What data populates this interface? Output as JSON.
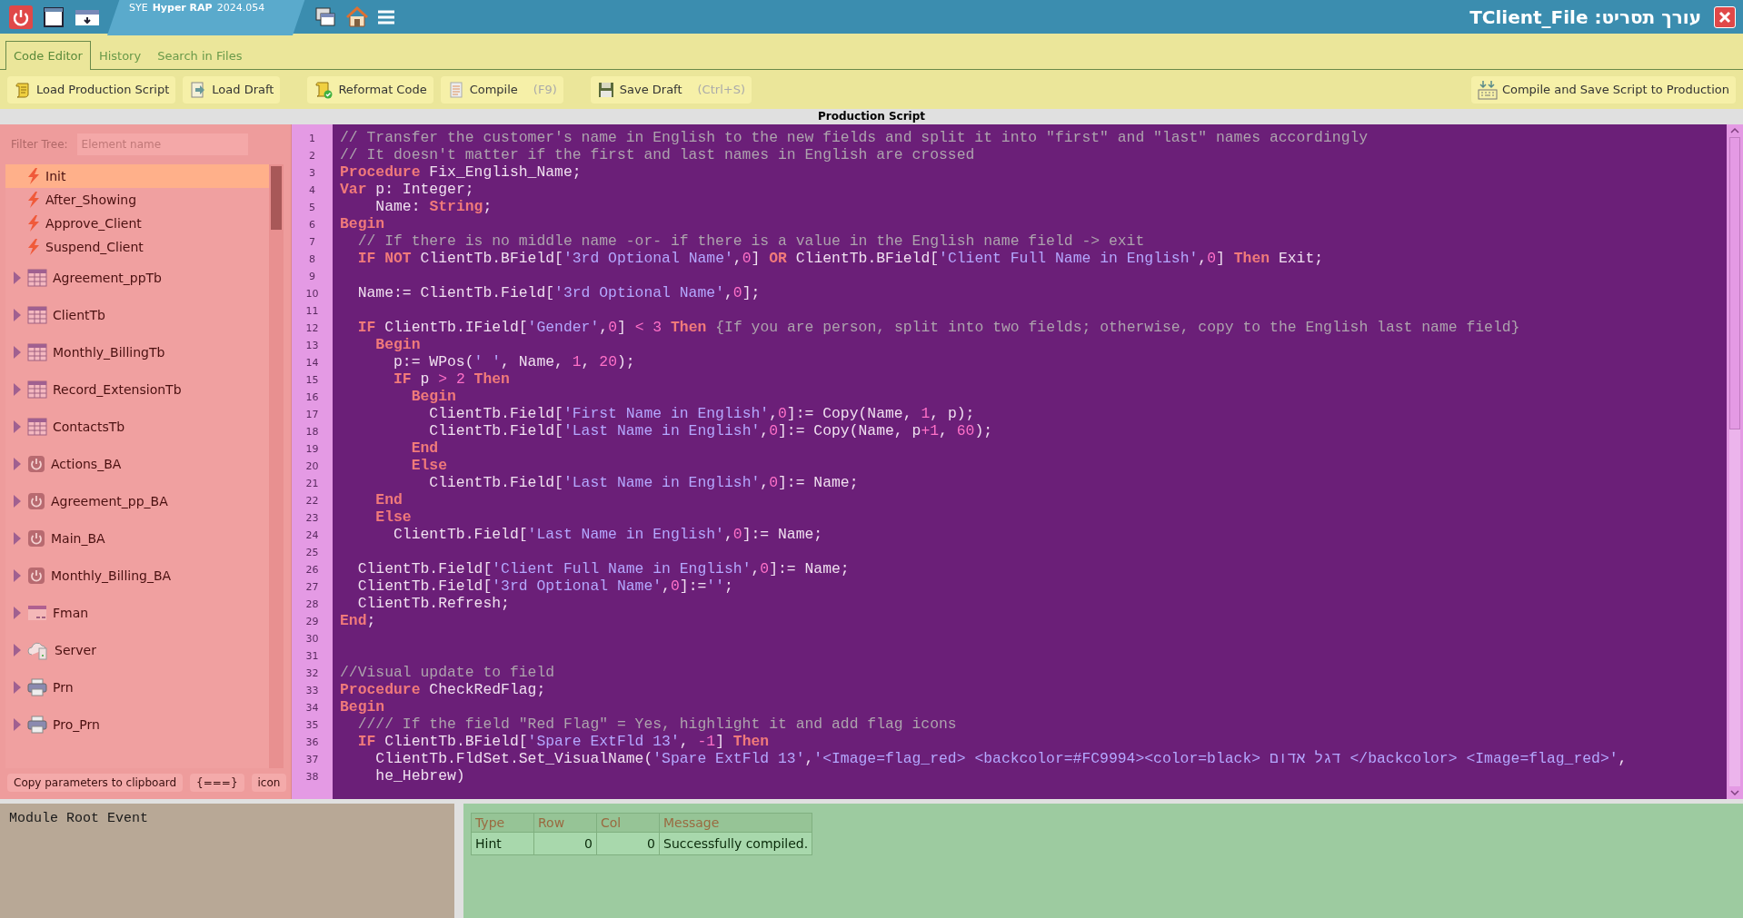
{
  "titlebar": {
    "app_name": "SYE",
    "app_bold": "Hyper RAP",
    "version": "2024.054",
    "title": "עורך תסריט: TClient_File"
  },
  "tabs": [
    {
      "label": "Code Editor",
      "selected": true
    },
    {
      "label": "History",
      "selected": false
    },
    {
      "label": "Search in Files",
      "selected": false
    }
  ],
  "toolbar": {
    "groups": [
      {
        "buttons": [
          {
            "kind": "load",
            "label": "Load Production Script"
          },
          {
            "kind": "draft",
            "label": "Load Draft"
          }
        ]
      },
      {
        "buttons": [
          {
            "kind": "reformat",
            "label": "Reformat Code"
          },
          {
            "kind": "compile",
            "label": "Compile",
            "shortcut": "(F9)"
          }
        ]
      },
      {
        "buttons": [
          {
            "kind": "save",
            "label": "Save Draft",
            "shortcut": "(Ctrl+S)"
          }
        ]
      }
    ],
    "right_button": {
      "kind": "publish",
      "label": "Compile and Save Script to Production"
    }
  },
  "editor_title": "Production Script",
  "sidebar": {
    "filter_label": "Filter Tree:",
    "filter_placeholder": "Element name",
    "items": [
      {
        "kind": "event",
        "label": "Init",
        "selected": true
      },
      {
        "kind": "event",
        "label": "After_Showing",
        "selected": false
      },
      {
        "kind": "event",
        "label": "Approve_Client",
        "selected": false
      },
      {
        "kind": "event",
        "label": "Suspend_Client",
        "selected": false
      },
      {
        "kind": "table",
        "label": "Agreement_ppTb",
        "selected": false,
        "expanded": false
      },
      {
        "kind": "table",
        "label": "ClientTb",
        "selected": false,
        "expanded": false
      },
      {
        "kind": "table",
        "label": "Monthly_BillingTb",
        "selected": false,
        "expanded": false
      },
      {
        "kind": "table",
        "label": "Record_ExtensionTb",
        "selected": false,
        "expanded": false
      },
      {
        "kind": "table",
        "label": "ContactsTb",
        "selected": false,
        "expanded": false
      },
      {
        "kind": "action",
        "label": "Actions_BA",
        "selected": false,
        "expanded": false
      },
      {
        "kind": "action",
        "label": "Agreement_pp_BA",
        "selected": false,
        "expanded": false
      },
      {
        "kind": "action",
        "label": "Main_BA",
        "selected": false,
        "expanded": false
      },
      {
        "kind": "action",
        "label": "Monthly_Billing_BA",
        "selected": false,
        "expanded": false
      },
      {
        "kind": "form",
        "label": "Fman",
        "selected": false,
        "expanded": false
      },
      {
        "kind": "server",
        "label": "Server",
        "selected": false,
        "expanded": false
      },
      {
        "kind": "printer",
        "label": "Prn",
        "selected": false,
        "expanded": false
      },
      {
        "kind": "printer",
        "label": "Pro_Prn",
        "selected": false,
        "expanded": false
      }
    ],
    "buttons": [
      "Copy parameters to clipboard",
      "{===}",
      "icon"
    ]
  },
  "code_lines": [
    {
      "number": "1",
      "tokens": [
        {
          "kind": "comment",
          "text": "// Transfer the customer's name in English to the new fields and split it into \"first\" and \"last\" names accordingly"
        }
      ]
    },
    {
      "number": "2",
      "tokens": [
        {
          "kind": "comment",
          "text": "// It doesn't matter if the first and last names in English are crossed"
        }
      ]
    },
    {
      "number": "3",
      "tokens": [
        {
          "kind": "keyword",
          "text": "Procedure"
        },
        {
          "kind": "plain",
          "text": " Fix_English_Name;"
        }
      ]
    },
    {
      "number": "4",
      "tokens": [
        {
          "kind": "keyword",
          "text": "Var"
        },
        {
          "kind": "plain",
          "text": " p: Integer;"
        }
      ]
    },
    {
      "number": "5",
      "tokens": [
        {
          "kind": "plain",
          "text": "    Name: "
        },
        {
          "kind": "keyword",
          "text": "String"
        },
        {
          "kind": "plain",
          "text": ";"
        }
      ]
    },
    {
      "number": "6",
      "tokens": [
        {
          "kind": "keyword",
          "text": "Begin"
        }
      ]
    },
    {
      "number": "7",
      "tokens": [
        {
          "kind": "comment",
          "text": "  // If there is no middle name -or- if there is a value in the English name field -> exit"
        }
      ]
    },
    {
      "number": "8",
      "tokens": [
        {
          "kind": "keyword",
          "text": "  IF NOT"
        },
        {
          "kind": "plain",
          "text": " ClientTb.BField["
        },
        {
          "kind": "string",
          "text": "'3rd Optional Name'"
        },
        {
          "kind": "plain",
          "text": ","
        },
        {
          "kind": "number",
          "text": "0"
        },
        {
          "kind": "plain",
          "text": "] "
        },
        {
          "kind": "keyword",
          "text": "OR"
        },
        {
          "kind": "plain",
          "text": " ClientTb.BField["
        },
        {
          "kind": "string",
          "text": "'Client Full Name in English'"
        },
        {
          "kind": "plain",
          "text": ","
        },
        {
          "kind": "number",
          "text": "0"
        },
        {
          "kind": "plain",
          "text": "] "
        },
        {
          "kind": "keyword",
          "text": "Then"
        },
        {
          "kind": "plain",
          "text": " Exit;"
        }
      ]
    },
    {
      "number": "9"
    },
    {
      "number": "10",
      "tokens": [
        {
          "kind": "plain",
          "text": "  Name:= ClientTb.Field["
        },
        {
          "kind": "string",
          "text": "'3rd Optional Name'"
        },
        {
          "kind": "plain",
          "text": ","
        },
        {
          "kind": "number",
          "text": "0"
        },
        {
          "kind": "plain",
          "text": "];"
        }
      ]
    },
    {
      "number": "11"
    },
    {
      "number": "12",
      "tokens": [
        {
          "kind": "keyword",
          "text": "  IF"
        },
        {
          "kind": "plain",
          "text": " ClientTb.IField["
        },
        {
          "kind": "string",
          "text": "'Gender'"
        },
        {
          "kind": "plain",
          "text": ","
        },
        {
          "kind": "number",
          "text": "0"
        },
        {
          "kind": "plain",
          "text": "] "
        },
        {
          "kind": "number",
          "text": "<"
        },
        {
          "kind": "number",
          "text": " 3"
        },
        {
          "kind": "keyword",
          "text": " Then"
        },
        {
          "kind": "comment",
          "text": " {If you are person, split into two fields; otherwise, copy to the English last name field}"
        }
      ]
    },
    {
      "number": "13",
      "tokens": [
        {
          "kind": "keyword",
          "text": "    Begin"
        }
      ]
    },
    {
      "number": "14",
      "tokens": [
        {
          "kind": "plain",
          "text": "      p:= WPos("
        },
        {
          "kind": "string",
          "text": "' '"
        },
        {
          "kind": "plain",
          "text": ", Name, "
        },
        {
          "kind": "number",
          "text": "1"
        },
        {
          "kind": "plain",
          "text": ", "
        },
        {
          "kind": "number",
          "text": "20"
        },
        {
          "kind": "plain",
          "text": ");"
        }
      ]
    },
    {
      "number": "15",
      "tokens": [
        {
          "kind": "keyword",
          "text": "      IF"
        },
        {
          "kind": "plain",
          "text": " p "
        },
        {
          "kind": "number",
          "text": ">"
        },
        {
          "kind": "number",
          "text": " 2"
        },
        {
          "kind": "keyword",
          "text": " Then"
        }
      ]
    },
    {
      "number": "16",
      "tokens": [
        {
          "kind": "keyword",
          "text": "        Begin"
        }
      ]
    },
    {
      "number": "17",
      "tokens": [
        {
          "kind": "plain",
          "text": "          ClientTb.Field["
        },
        {
          "kind": "string",
          "text": "'First Name in English'"
        },
        {
          "kind": "plain",
          "text": ","
        },
        {
          "kind": "number",
          "text": "0"
        },
        {
          "kind": "plain",
          "text": "]:= Copy(Name, "
        },
        {
          "kind": "number",
          "text": "1"
        },
        {
          "kind": "plain",
          "text": ", p);"
        }
      ]
    },
    {
      "number": "18",
      "tokens": [
        {
          "kind": "plain",
          "text": "          ClientTb.Field["
        },
        {
          "kind": "string",
          "text": "'Last Name in English'"
        },
        {
          "kind": "plain",
          "text": ","
        },
        {
          "kind": "number",
          "text": "0"
        },
        {
          "kind": "plain",
          "text": "]:= Copy(Name, p"
        },
        {
          "kind": "number",
          "text": "+1"
        },
        {
          "kind": "plain",
          "text": ", "
        },
        {
          "kind": "number",
          "text": "60"
        },
        {
          "kind": "plain",
          "text": ");"
        }
      ]
    },
    {
      "number": "19",
      "tokens": [
        {
          "kind": "keyword",
          "text": "        End"
        }
      ]
    },
    {
      "number": "20",
      "tokens": [
        {
          "kind": "keyword",
          "text": "        Else"
        }
      ]
    },
    {
      "number": "21",
      "tokens": [
        {
          "kind": "plain",
          "text": "          ClientTb.Field["
        },
        {
          "kind": "string",
          "text": "'Last Name in English'"
        },
        {
          "kind": "plain",
          "text": ","
        },
        {
          "kind": "number",
          "text": "0"
        },
        {
          "kind": "plain",
          "text": "]:= Name;"
        }
      ]
    },
    {
      "number": "22",
      "tokens": [
        {
          "kind": "keyword",
          "text": "    End"
        }
      ]
    },
    {
      "number": "23",
      "tokens": [
        {
          "kind": "keyword",
          "text": "    Else"
        }
      ]
    },
    {
      "number": "24",
      "tokens": [
        {
          "kind": "plain",
          "text": "      ClientTb.Field["
        },
        {
          "kind": "string",
          "text": "'Last Name in English'"
        },
        {
          "kind": "plain",
          "text": ","
        },
        {
          "kind": "number",
          "text": "0"
        },
        {
          "kind": "plain",
          "text": "]:= Name;"
        }
      ]
    },
    {
      "number": "25"
    },
    {
      "number": "26",
      "tokens": [
        {
          "kind": "plain",
          "text": "  ClientTb.Field["
        },
        {
          "kind": "string",
          "text": "'Client Full Name in English'"
        },
        {
          "kind": "plain",
          "text": ","
        },
        {
          "kind": "number",
          "text": "0"
        },
        {
          "kind": "plain",
          "text": "]:= Name;"
        }
      ]
    },
    {
      "number": "27",
      "tokens": [
        {
          "kind": "plain",
          "text": "  ClientTb.Field["
        },
        {
          "kind": "string",
          "text": "'3rd Optional Name'"
        },
        {
          "kind": "plain",
          "text": ","
        },
        {
          "kind": "number",
          "text": "0"
        },
        {
          "kind": "plain",
          "text": "]:="
        },
        {
          "kind": "string",
          "text": "''"
        },
        {
          "kind": "plain",
          "text": ";"
        }
      ]
    },
    {
      "number": "28",
      "tokens": [
        {
          "kind": "plain",
          "text": "  ClientTb.Refresh;"
        }
      ]
    },
    {
      "number": "29",
      "tokens": [
        {
          "kind": "keyword",
          "text": "End"
        },
        {
          "kind": "plain",
          "text": ";"
        }
      ]
    },
    {
      "number": "30"
    },
    {
      "number": "31"
    },
    {
      "number": "32",
      "tokens": [
        {
          "kind": "comment",
          "text": "//Visual update to field"
        }
      ]
    },
    {
      "number": "33",
      "tokens": [
        {
          "kind": "keyword",
          "text": "Procedure"
        },
        {
          "kind": "plain",
          "text": " CheckRedFlag;"
        }
      ]
    },
    {
      "number": "34",
      "tokens": [
        {
          "kind": "keyword",
          "text": "Begin"
        }
      ]
    },
    {
      "number": "35",
      "tokens": [
        {
          "kind": "comment",
          "text": "  //// If the field \"Red Flag\" = Yes, highlight it and add flag icons"
        }
      ]
    },
    {
      "number": "36",
      "tokens": [
        {
          "kind": "keyword",
          "text": "  IF"
        },
        {
          "kind": "plain",
          "text": " ClientTb.BField["
        },
        {
          "kind": "string",
          "text": "'Spare ExtFld 13'"
        },
        {
          "kind": "plain",
          "text": ", "
        },
        {
          "kind": "number",
          "text": "-1"
        },
        {
          "kind": "plain",
          "text": "] "
        },
        {
          "kind": "keyword",
          "text": "Then"
        }
      ]
    },
    {
      "number": "37",
      "tokens": [
        {
          "kind": "plain",
          "text": "    ClientTb.FldSet.Set_VisualName("
        },
        {
          "kind": "string",
          "text": "'Spare ExtFld 13'"
        },
        {
          "kind": "plain",
          "text": ","
        },
        {
          "kind": "string",
          "text": "'<Image=flag_red> <backcolor=#FC9994><color=black> דגל אדום </backcolor> <Image=flag_red>'"
        },
        {
          "kind": "plain",
          "text": ","
        }
      ]
    },
    {
      "number": "38",
      "tokens": [
        {
          "kind": "plain",
          "text": "    he_Hebrew)"
        }
      ]
    }
  ],
  "event_panel": {
    "text": "Module Root Event"
  },
  "messages": {
    "columns": [
      "Type",
      "Row",
      "Col",
      "Message"
    ],
    "rows": [
      [
        "Hint",
        "0",
        "0",
        "Successfully compiled."
      ]
    ]
  }
}
